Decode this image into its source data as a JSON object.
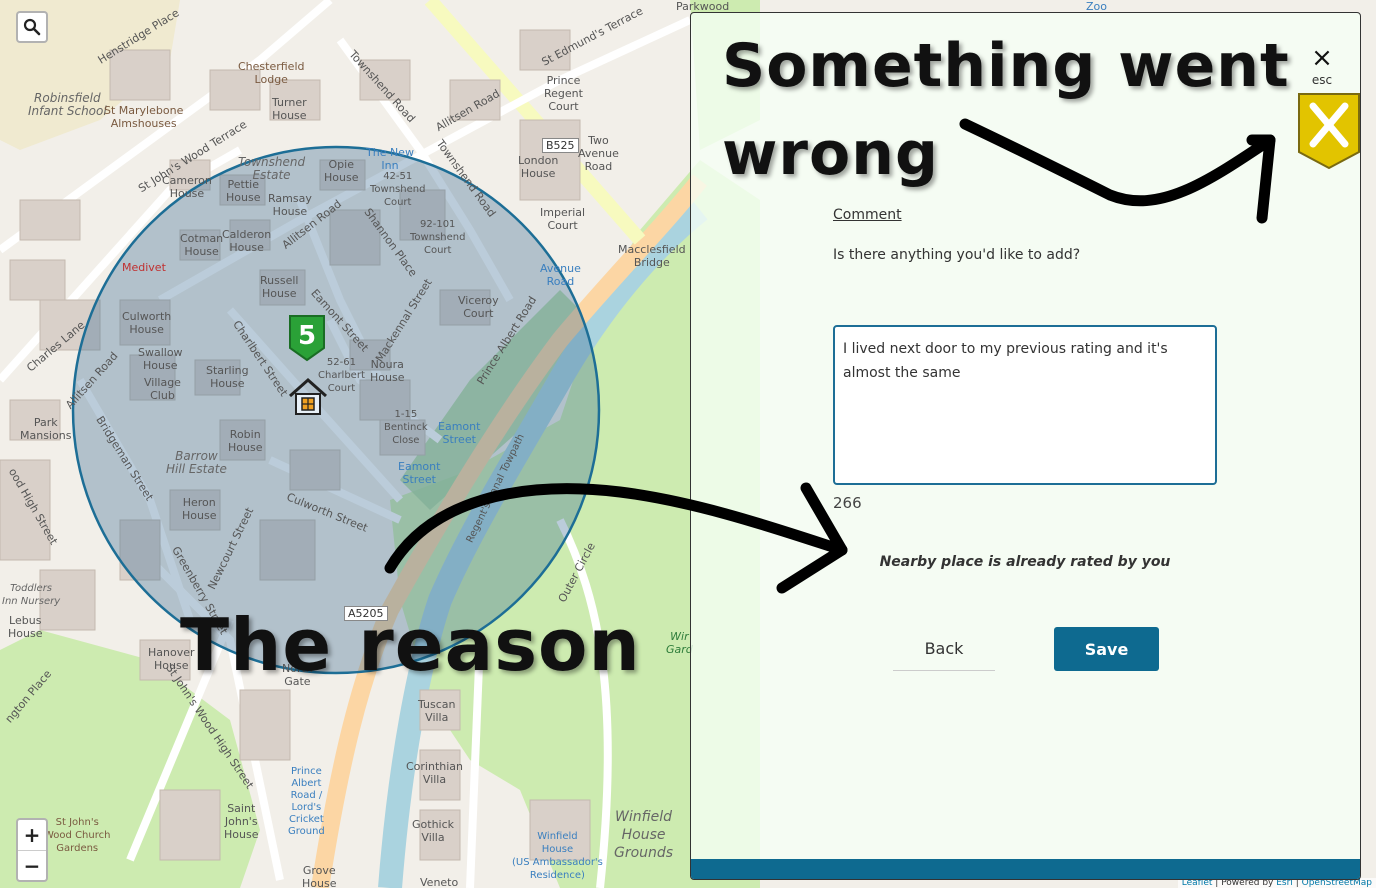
{
  "map": {
    "search_icon": "magnifier-icon",
    "zoom_in_label": "+",
    "zoom_out_label": "−",
    "marker_rating": "5",
    "attribution": {
      "leaflet": "Leaflet",
      "powered": "| Powered by",
      "esri": "Esri",
      "sep": "|",
      "osm": "OpenStreetMap"
    },
    "road_shields": {
      "b525": "B525",
      "a5205": "A5205"
    },
    "labels": {
      "henstridge": "Henstridge Place",
      "robinsfield": "Robinsfield\nInfant School",
      "st_marylebone": "St Marylebone\nAlmshouses",
      "chesterfield": "Chesterfield\nLodge",
      "turner": "Turner\nHouse",
      "townshend_road": "Townshend Road",
      "allitsen_road_top": "Allitsen Road",
      "st_edmunds": "St Edmund's Terrace",
      "prince_regent": "Prince\nRegent\nCourt",
      "two_avenue": "Two\nAvenue\nRoad",
      "london_house": "London\nHouse",
      "imperial": "Imperial\nCourt",
      "macclesfield": "Macclesfield\nBridge",
      "st_johns_wood_terrace": "St John's Wood Terrace",
      "cameron": "Cameron\nHouse",
      "townshend_estate": "Townshend\nEstate",
      "pettie": "Pettie\nHouse",
      "ramsay": "Ramsay\nHouse",
      "opie": "Opie\nHouse",
      "new_inn": "The New\nInn",
      "tw_court": "42-51\nTownshend\nCourt",
      "tw_court2": "92-101\nTownshend\nCourt",
      "shannon": "Shannon Place",
      "townshend_road2": "Townshend Road",
      "medivet": "Medivet",
      "cotman": "Cotman\nHouse",
      "calderon": "Calderon\nHouse",
      "allitsen_road_mid": "Allitsen Road",
      "avenue_road": "Avenue\nRoad",
      "russell": "Russell\nHouse",
      "viceroy": "Viceroy\nCourt",
      "culworth_house": "Culworth\nHouse",
      "eamont_street": "Eamont Street",
      "mackennal": "Mackennal Street",
      "charles_lane": "Charles Lane",
      "swallow": "Swallow\nHouse",
      "village_club": "Village\nClub",
      "starling": "Starling\nHouse",
      "charlbert_street": "Charlbert Street",
      "charlbert_court": "52-61\nCharlbert\nCourt",
      "noura": "Noura\nHouse",
      "prince_albert_road": "Prince Albert Road",
      "allitsen_road_left": "Allitsen Road",
      "park_mansions": "Park\nMansions",
      "bridgeman": "Bridgeman Street",
      "robin": "Robin\nHouse",
      "bentinck": "1-15\nBentinck\nClose",
      "eamont_stop1": "Eamont\nStreet",
      "eamont_stop2": "Eamont\nStreet",
      "barrow_hill": "Barrow\nHill Estate",
      "heron": "Heron\nHouse",
      "culworth_street": "Culworth Street",
      "regents_canal": "Regent's Canal Towpath",
      "outer_circle": "Outer Circle",
      "newcourt": "Newcourt Street",
      "greenberry": "Greenberry Street",
      "toddlers": "Toddlers\nInn Nursery",
      "lebus": "Lebus\nHouse",
      "hanover": "Hanover\nHouse",
      "st_johns_wood_high": "St John's Wood High Street",
      "north_gate": "North\nGate",
      "tuscan": "Tuscan\nVilla",
      "corinthian": "Corinthian\nVilla",
      "gothick": "Gothick\nVilla",
      "winfield_house_blue": "Winfield\nHouse\n(US Ambassador's\nResidence)",
      "winfield_grounds": "Winfield\nHouse\nGrounds",
      "prince_albert_stop": "Prince\nAlbert\nRoad /\nLord's\nCricket\nGround",
      "st_johns_house": "Saint\nJohn's\nHouse",
      "st_johns_church": "St John's\nWood Church\nGardens",
      "grove": "Grove\nHouse",
      "veneto": "Veneto",
      "wir_garden": "Wir\nGard",
      "parkwood": "Parkwood",
      "zoo": "Zoo",
      "abington": "ngton Place",
      "wood_high": "ood High Street"
    }
  },
  "panel": {
    "close_label": "×",
    "esc_label": "esc",
    "comment_link": "Comment",
    "comment_question": "Is there anything you'd like to add?",
    "comment_value": "I lived next door to my previous rating and it's almost the same",
    "char_count": "266",
    "error_message": "Nearby place is already rated by you",
    "back_label": "Back",
    "save_label": "Save"
  },
  "annotations": {
    "title_line1": "Something went",
    "title_line2": "wrong",
    "reason": "The reason"
  },
  "colors": {
    "accent": "#0e6a90",
    "marker_green": "#2aa137",
    "circle_stroke": "#1d6e96",
    "badge_yellow": "#e2c400"
  }
}
